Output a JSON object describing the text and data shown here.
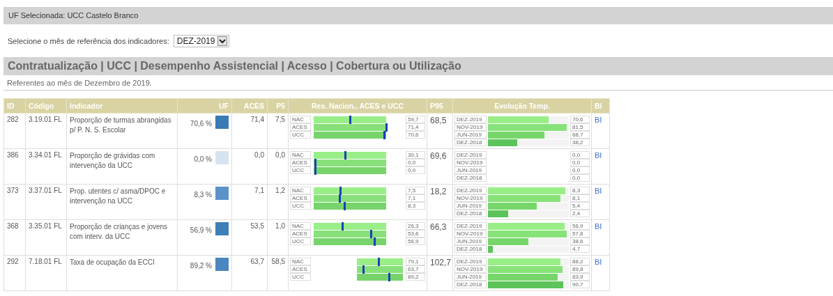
{
  "selected_unit": "UF Selecionada: UCC Castelo Branco",
  "month_selector": {
    "label": "Selecione o mês de referência dos indicadores:",
    "value": "DEZ-2019"
  },
  "section": {
    "title": "Contratualização | UCC | Desempenho Assistencial | Acesso | Cobertura ou Utilização",
    "subtitle": "Referentes ao mês de Dezembro de 2019."
  },
  "table": {
    "columns": [
      "ID",
      "Código",
      "Indicador",
      "UF",
      "ACES",
      "P5",
      "Res. Nacion., ACES e UCC",
      "P95",
      "Evolução Temp.",
      "BI"
    ],
    "rows": [
      {
        "id": "282",
        "code": "3.19.01 FL",
        "indicator": "Proporção de turmas abrangidas p/ P. N. S. Escolar",
        "uf": "70,6 %",
        "color": "#3a7ab5",
        "aces": "71,4",
        "p5": "7,5",
        "p95": "68,5",
        "bi": "BI",
        "results": [
          {
            "label": "NAC",
            "value": "59,7",
            "level": 0.5
          },
          {
            "label": "ACES",
            "value": "71,4",
            "level": 1.0
          },
          {
            "label": "UCC",
            "value": "70,6",
            "level": 0.97
          }
        ],
        "evolution": [
          {
            "month": "DEZ-2019",
            "value": "70,6",
            "level": 0.75
          },
          {
            "month": "NOV-2019",
            "value": "81,5",
            "level": 0.97
          },
          {
            "month": "JUN-2019",
            "value": "68,7",
            "level": 0.7
          },
          {
            "month": "DEZ-2018",
            "value": "38,2",
            "level": 0.36
          }
        ]
      },
      {
        "id": "386",
        "code": "3.34.01 FL",
        "indicator": "Proporção de grávidas com intervenção da UCC",
        "uf": "0,0 %",
        "color": "#d5e4f0",
        "aces": "0,0",
        "p5": "0,0",
        "p95": "69,6",
        "bi": "BI",
        "results": [
          {
            "label": "NAC",
            "value": "30,1",
            "level": 0.43
          },
          {
            "label": "ACES",
            "value": "0,0",
            "level": 0.02
          },
          {
            "label": "UCC",
            "value": "0,0",
            "level": 0.02
          }
        ],
        "evolution": [
          {
            "month": "DEZ-2019",
            "value": "0,0"
          },
          {
            "month": "NOV-2019",
            "value": "0,0"
          },
          {
            "month": "JUN-2019",
            "value": "0,0"
          },
          {
            "month": "DEZ-2018",
            "value": "0,0"
          }
        ]
      },
      {
        "id": "373",
        "code": "3.37.01 FL",
        "indicator": "Prop. utentes c/ asma/DPOC e intervenção na UCC",
        "uf": "8,3 %",
        "color": "#5b93c8",
        "aces": "7,1",
        "p5": "1,2",
        "p95": "18,2",
        "bi": "BI",
        "results": [
          {
            "label": "NAC",
            "value": "7,5",
            "level": 0.37
          },
          {
            "label": "ACES",
            "value": "7,1",
            "level": 0.36
          },
          {
            "label": "UCC",
            "value": "8,3",
            "level": 0.42
          }
        ],
        "evolution": [
          {
            "month": "DEZ-2019",
            "value": "8,3",
            "level": 0.96
          },
          {
            "month": "NOV-2019",
            "value": "8,1",
            "level": 0.9
          },
          {
            "month": "JUN-2019",
            "value": "5,4",
            "level": 0.6
          },
          {
            "month": "DEZ-2018",
            "value": "2,4",
            "level": 0.25
          }
        ]
      },
      {
        "id": "368",
        "code": "3.35.01 FL",
        "indicator": "Proporção de crianças e jovens com interv. da UCC",
        "uf": "56,9 %",
        "color": "#3f7fb8",
        "aces": "53,5",
        "p5": "1,0",
        "p95": "66,3",
        "bi": "BI",
        "results": [
          {
            "label": "NAC",
            "value": "26,3",
            "level": 0.39
          },
          {
            "label": "ACES",
            "value": "53,6",
            "level": 0.79
          },
          {
            "label": "UCC",
            "value": "56,9",
            "level": 0.84
          }
        ],
        "evolution": [
          {
            "month": "DEZ-2019",
            "value": "56,9",
            "level": 0.95
          },
          {
            "month": "NOV-2019",
            "value": "57,8",
            "level": 0.97
          },
          {
            "month": "JUN-2019",
            "value": "38,6",
            "level": 0.5
          },
          {
            "month": "DEZ-2018",
            "value": "4,7",
            "level": 0.06
          }
        ]
      },
      {
        "id": "292",
        "code": "7.18.01 FL",
        "indicator": "Taxa de ocupação da ECCI",
        "uf": "89,2 %",
        "color": "#4a86bf",
        "aces": "63,7",
        "p5": "58,5",
        "p95": "102,7",
        "bi": "BI",
        "results": [
          {
            "label": "NAC",
            "value": "79,1",
            "level": 0.47
          },
          {
            "label": "ACES",
            "value": "63,7",
            "level": 0.13
          },
          {
            "label": "UCC",
            "value": "89,2",
            "level": 0.69
          }
        ],
        "evolution": [
          {
            "month": "DEZ-2019",
            "value": "88,2",
            "level": 0.9
          },
          {
            "month": "NOV-2019",
            "value": "89,8",
            "level": 0.92
          },
          {
            "month": "JUN-2019",
            "value": "83,9",
            "level": 0.86
          },
          {
            "month": "DEZ-2018",
            "value": "90,7",
            "level": 0.93
          }
        ]
      }
    ]
  }
}
